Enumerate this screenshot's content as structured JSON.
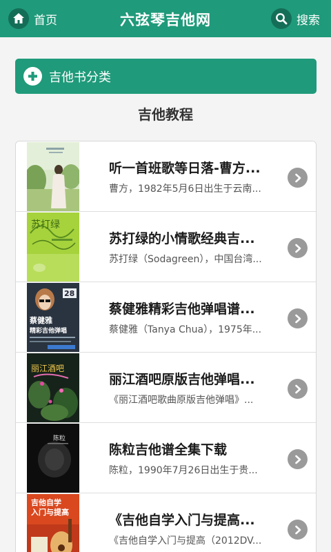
{
  "topbar": {
    "home_label": "首页",
    "title": "六弦琴吉他网",
    "search_label": "搜索"
  },
  "category_button": {
    "label": "吉他书分类"
  },
  "section_title": "吉他教程",
  "items": [
    {
      "title": "听一首班歌等日落-曹方...",
      "desc": "曹方，1982年5月6日出生于云南...",
      "cover_icon": "book-cover-cao-fang"
    },
    {
      "title": "苏打绿的小情歌经典吉...",
      "desc": "苏打绿（Sodagreen），中国台湾...",
      "cover_icon": "book-cover-sodagreen"
    },
    {
      "title": "蔡健雅精彩吉他弹唱谱...",
      "desc": "蔡健雅（Tanya Chua），1975年...",
      "cover_icon": "book-cover-tanya-chua"
    },
    {
      "title": "丽江酒吧原版吉他弹唱...",
      "desc": "《丽江酒吧歌曲原版吉他弹唱》...",
      "cover_icon": "book-cover-lijiang-bar"
    },
    {
      "title": "陈粒吉他谱全集下载",
      "desc": "陈粒，1990年7月26日出生于贵...",
      "cover_icon": "book-cover-chen-li"
    },
    {
      "title": "《吉他自学入门与提高...",
      "desc": "《吉他自学入门与提高（2012DV...",
      "cover_icon": "book-cover-guitar-self-study"
    }
  ],
  "cover_text": {
    "sodagreen": "苏打绿",
    "tanya_title": "蔡健雅",
    "tanya_sub": "精彩吉他弹唱",
    "tanya_badge": "28",
    "lijiang": "丽江酒吧",
    "chenli": "陈粒",
    "guitar_title1": "吉他自学",
    "guitar_title2": "入门与提高"
  },
  "colors": {
    "accent": "#1f9a7a",
    "accent_dark": "#146e57",
    "arrow": "#9a9a9a"
  }
}
